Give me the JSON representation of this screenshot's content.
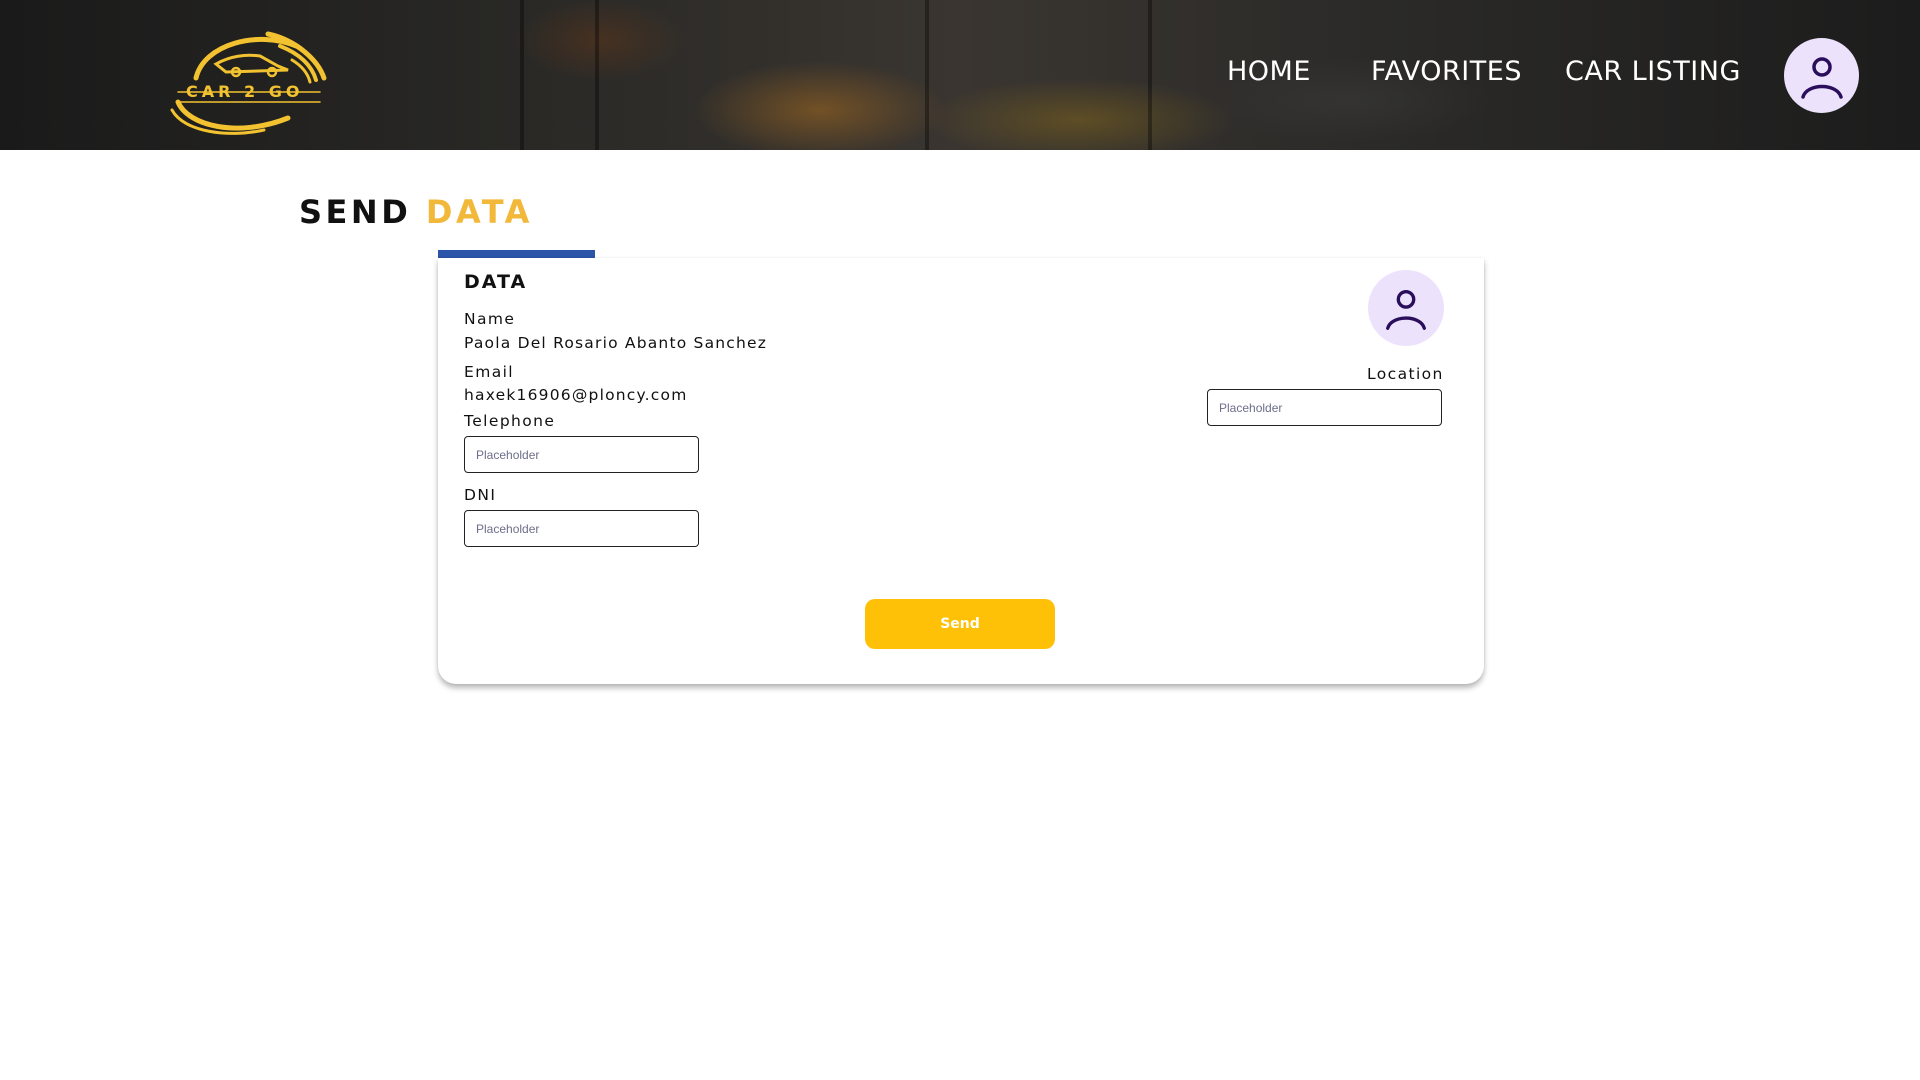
{
  "header": {
    "logo_text": "CAR 2 GO",
    "nav": {
      "home": "HOME",
      "favorites": "FAVORITES",
      "car_listing": "CAR LISTING"
    },
    "avatar_icon": "user-icon"
  },
  "page": {
    "title_part1": "SEND",
    "title_part2": "DATA"
  },
  "card": {
    "heading": "DATA",
    "name_label": "Name",
    "name_value": "Paola Del Rosario Abanto Sanchez",
    "email_label": "Email",
    "email_value": "haxek16906@ploncy.com",
    "telephone_label": "Telephone",
    "telephone_placeholder": "Placeholder",
    "dni_label": "DNI",
    "dni_placeholder": "Placeholder",
    "location_label": "Location",
    "location_placeholder": "Placeholder",
    "avatar_icon": "user-icon",
    "send_label": "Send"
  },
  "colors": {
    "accent_yellow": "#ffc107",
    "title_yellow": "#f2b83a",
    "accent_blue": "#2b55a8",
    "avatar_bg": "#ece2fb",
    "avatar_fg": "#2a0e5c"
  }
}
